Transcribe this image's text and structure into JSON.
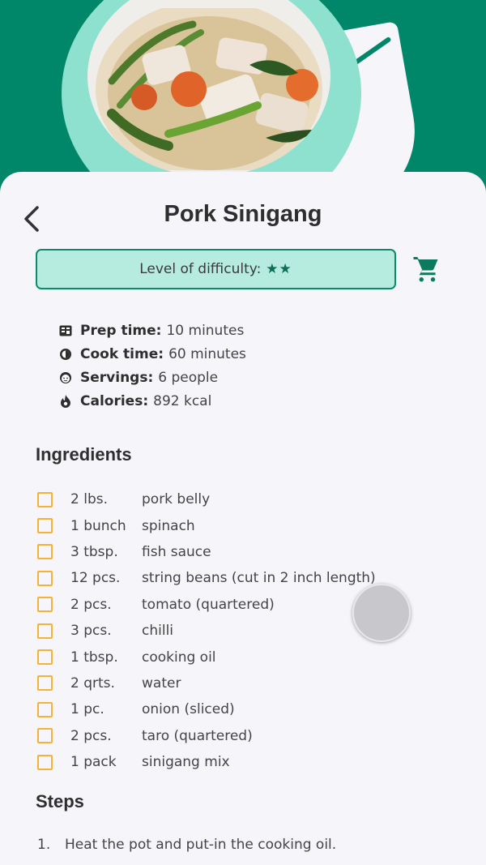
{
  "recipe": {
    "title": "Pork Sinigang",
    "difficulty_label": "Level of difficulty:",
    "difficulty_stars": "★★"
  },
  "info": [
    {
      "icon": "prep-time-icon",
      "label": "Prep time:",
      "value": "10 minutes"
    },
    {
      "icon": "cook-time-icon",
      "label": "Cook time:",
      "value": "60 minutes"
    },
    {
      "icon": "servings-icon",
      "label": "Servings:",
      "value": "6 people"
    },
    {
      "icon": "calories-icon",
      "label": "Calories:",
      "value": "892 kcal"
    }
  ],
  "sections": {
    "ingredients": "Ingredients",
    "steps": "Steps"
  },
  "ingredients": [
    {
      "qty": "2 lbs.",
      "item": "pork belly"
    },
    {
      "qty": "1 bunch",
      "item": "spinach"
    },
    {
      "qty": "3 tbsp.",
      "item": "fish sauce"
    },
    {
      "qty": "12 pcs.",
      "item": "string beans (cut in 2 inch length)"
    },
    {
      "qty": "2 pcs.",
      "item": "tomato (quartered)"
    },
    {
      "qty": "3 pcs.",
      "item": "chilli"
    },
    {
      "qty": "1 tbsp.",
      "item": "cooking oil"
    },
    {
      "qty": "2 qrts.",
      "item": "water"
    },
    {
      "qty": "1 pc.",
      "item": "onion (sliced)"
    },
    {
      "qty": "2 pcs.",
      "item": "taro (quartered)"
    },
    {
      "qty": "1 pack",
      "item": "sinigang mix"
    }
  ],
  "steps": [
    {
      "num": "1.",
      "text": "Heat the pot and put-in the cooking oil."
    }
  ],
  "colors": {
    "brand_green": "#00876a",
    "accent_mint": "#b6ece0",
    "checkbox_orange": "#f2b33a",
    "background": "#f6f5f9"
  }
}
